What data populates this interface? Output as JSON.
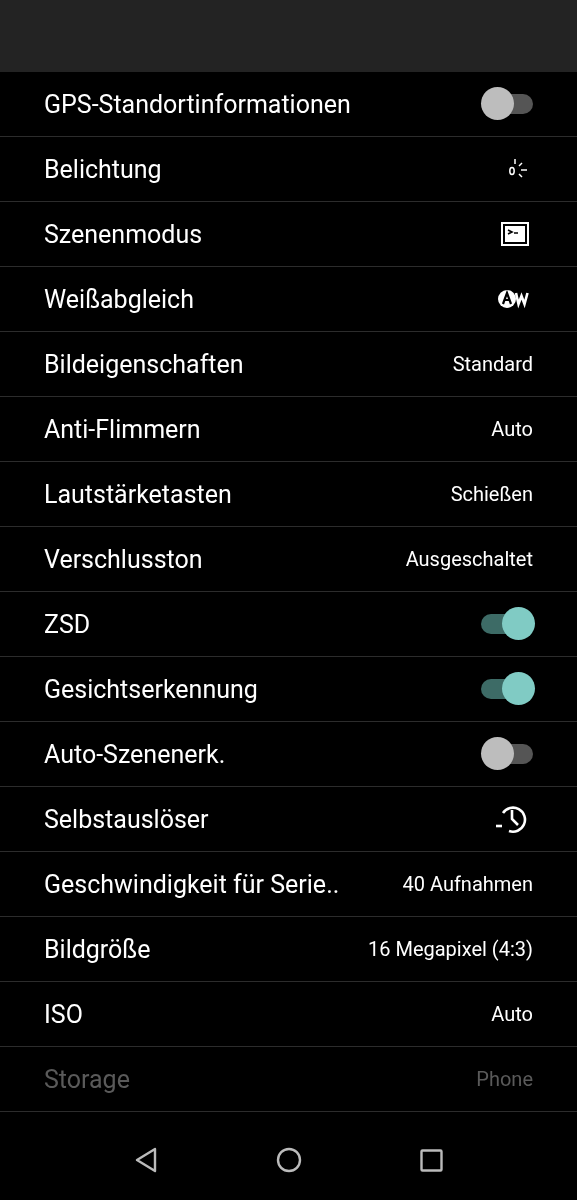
{
  "settings": [
    {
      "label": "GPS-Standortinformationen",
      "kind": "toggle",
      "on": false,
      "disabled": false
    },
    {
      "label": "Belichtung",
      "kind": "exposure",
      "disabled": false
    },
    {
      "label": "Szenenmodus",
      "kind": "scene",
      "disabled": false
    },
    {
      "label": "Weißabgleich",
      "kind": "whitebalance",
      "disabled": false
    },
    {
      "label": "Bildeigenschaften",
      "kind": "value",
      "value": "Standard",
      "disabled": false
    },
    {
      "label": "Anti-Flimmern",
      "kind": "value",
      "value": "Auto",
      "disabled": false
    },
    {
      "label": "Lautstärketasten",
      "kind": "value",
      "value": "Schießen",
      "disabled": false
    },
    {
      "label": "Verschlusston",
      "kind": "value",
      "value": "Ausgeschaltet",
      "disabled": false
    },
    {
      "label": "ZSD",
      "kind": "toggle",
      "on": true,
      "disabled": false
    },
    {
      "label": "Gesichtserkennung",
      "kind": "toggle",
      "on": true,
      "disabled": false
    },
    {
      "label": "Auto-Szenenerk.",
      "kind": "toggle",
      "on": false,
      "disabled": false
    },
    {
      "label": "Selbstauslöser",
      "kind": "timer",
      "disabled": false
    },
    {
      "label": "Geschwindigkeit für Serie..",
      "kind": "value",
      "value": "40 Aufnahmen",
      "disabled": false
    },
    {
      "label": "Bildgröße",
      "kind": "value",
      "value": "16 Megapixel (4:3)",
      "disabled": false
    },
    {
      "label": "ISO",
      "kind": "value",
      "value": "Auto",
      "disabled": false
    },
    {
      "label": "Storage",
      "kind": "value",
      "value": "Phone",
      "disabled": true
    }
  ]
}
